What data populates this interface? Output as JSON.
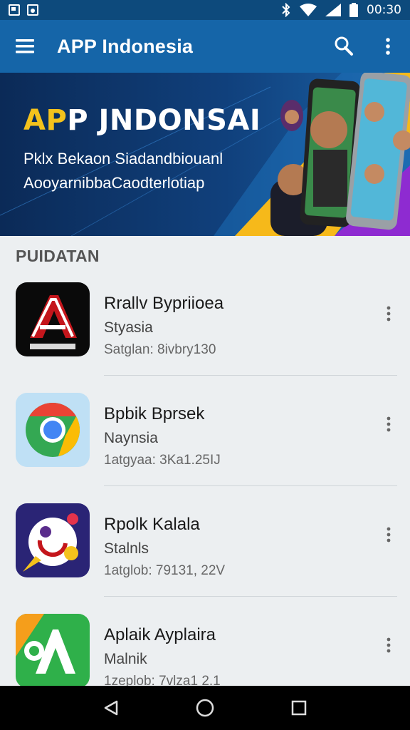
{
  "status_bar": {
    "time": "00:30",
    "icons": [
      "gallery-icon",
      "photo-icon",
      "bluetooth-icon",
      "wifi-icon",
      "signal-icon",
      "battery-icon"
    ]
  },
  "app_bar": {
    "title": "APP Indonesia",
    "icons": [
      "menu-icon",
      "share-icon",
      "more-vert-icon"
    ]
  },
  "banner": {
    "title_part1": "AP",
    "title_part2": "P JNDONSAI",
    "subtitle_line1": "Pklx Bekaon Siadandbiouanl",
    "subtitle_line2": "AooyarnibbaCaodterlotiap",
    "colors": {
      "title_yellow": "#f4c21c",
      "title_white": "#ffffff"
    }
  },
  "section": {
    "header": "PUIDATAN"
  },
  "apps": [
    {
      "name": "Rrallv Bypriioea",
      "category": "Styasia",
      "meta": "Satglan: 8ivbry130",
      "icon": "red-a-logo-icon"
    },
    {
      "name": "Bpbik Bprsek",
      "category": "Naynsia",
      "meta": "1atgyaa: 3Ka1.25IJ",
      "icon": "chrome-style-icon"
    },
    {
      "name": "Rpolk Kalala",
      "category": "Stalnls",
      "meta": "1atglob: 79131, 22V",
      "icon": "paint-face-icon"
    },
    {
      "name": "Aplaik Ayplaira",
      "category": "Malnik",
      "meta": "1zeplob: 7vlza1 2.1",
      "icon": "green-a-icon"
    }
  ],
  "nav_bar": {
    "icons": [
      "back-icon",
      "home-icon",
      "recents-icon"
    ]
  },
  "colors": {
    "primary": "#1565a8",
    "status_bar": "#0d4a7c",
    "background": "#eceff1"
  }
}
